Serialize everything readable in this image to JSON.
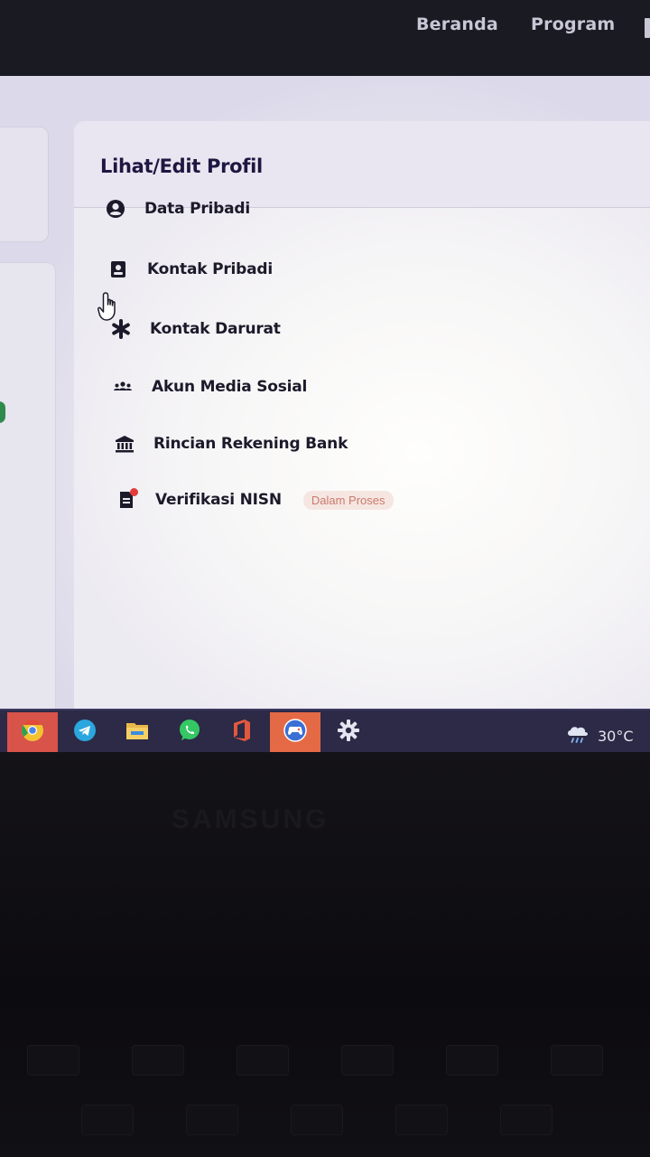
{
  "topnav": {
    "links": [
      "Beranda",
      "Program"
    ]
  },
  "profile": {
    "title": "Lihat/Edit Profil",
    "items": [
      {
        "label": "Data Pribadi",
        "icon": "user-circle-icon"
      },
      {
        "label": "Kontak Pribadi",
        "icon": "contact-icon"
      },
      {
        "label": "Kontak Darurat",
        "icon": "asterisk-icon"
      },
      {
        "label": "Akun Media Sosial",
        "icon": "people-icon"
      },
      {
        "label": "Rincian Rekening Bank",
        "icon": "bank-icon"
      },
      {
        "label": "Verifikasi NISN",
        "icon": "document-icon",
        "badge": "Dalam Proses"
      }
    ]
  },
  "taskbar": {
    "apps": [
      "chrome-icon",
      "telegram-icon",
      "file-explorer-icon",
      "whatsapp-icon",
      "office-icon",
      "game-controller-icon",
      "settings-icon"
    ],
    "active_app": "game-controller-icon",
    "weather": {
      "icon": "rain-cloud-icon",
      "temperature": "30°C"
    }
  },
  "device": {
    "brand": "SAMSUNG"
  },
  "colors": {
    "accent_text": "#1e1740",
    "badge_bg": "#f6e6e1",
    "badge_text": "#c97a6c",
    "notification": "#e23b3b",
    "taskbar": "#2c2a46"
  }
}
